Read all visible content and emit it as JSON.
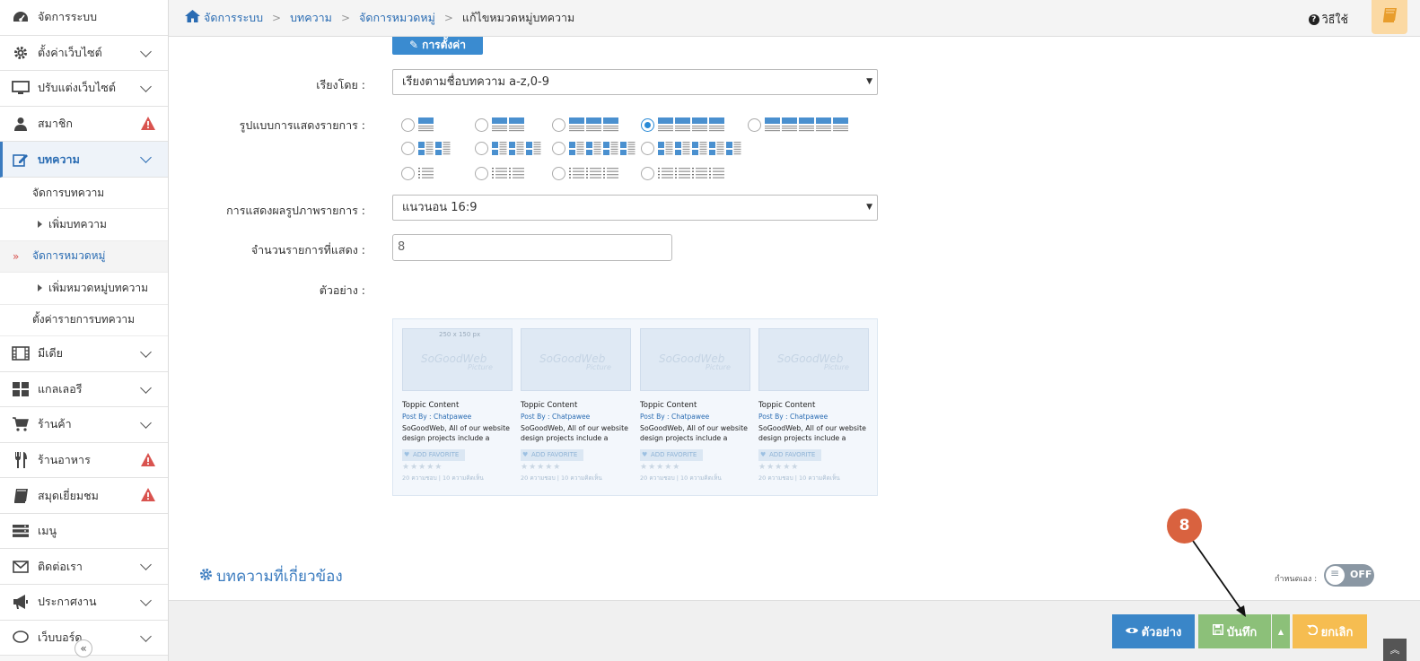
{
  "sidebar": {
    "items": [
      {
        "label": "จัดการระบบ",
        "icon": "dashboard-icon"
      },
      {
        "label": "ตั้งค่าเว็บไซต์",
        "icon": "gear-icon"
      },
      {
        "label": "ปรับแต่งเว็บไซต์",
        "icon": "monitor-icon"
      },
      {
        "label": "สมาชิก",
        "icon": "user-icon"
      },
      {
        "label": "บทความ",
        "icon": "edit-icon"
      },
      {
        "label": "มีเดีย",
        "icon": "film-icon"
      },
      {
        "label": "แกลเลอรี",
        "icon": "grid-icon"
      },
      {
        "label": "ร้านค้า",
        "icon": "cart-icon"
      },
      {
        "label": "ร้านอาหาร",
        "icon": "cutlery-icon"
      },
      {
        "label": "สมุดเยี่ยมชม",
        "icon": "book-icon"
      },
      {
        "label": "เมนู",
        "icon": "menu-icon"
      },
      {
        "label": "ติดต่อเรา",
        "icon": "envelope-icon"
      },
      {
        "label": "ประกาศงาน",
        "icon": "megaphone-icon"
      },
      {
        "label": "เว็บบอร์ด",
        "icon": "chat-icon"
      }
    ],
    "article_subitems": [
      "จัดการบทความ",
      "เพิ่มบทความ",
      "จัดการหมวดหมู่",
      "เพิ่มหมวดหมู่บทความ",
      "ตั้งค่ารายการบทความ"
    ],
    "collapse_label": "«"
  },
  "breadcrumb": [
    "จัดการระบบ",
    "บทความ",
    "จัดการหมวดหมู่",
    "แก้ไขหมวดหมู่บทความ"
  ],
  "header": {
    "help_label": "วิธีใช้"
  },
  "form": {
    "settings_button": "การตั้งค่า",
    "sort_label": "เรียงโดย :",
    "sort_value": "เรียงตามชื่อบทความ a-z,0-9",
    "layout_label": "รูปแบบการแสดงรายการ :",
    "image_label": "การแสดงผลรูปภาพรายการ :",
    "image_value": "แนวนอน 16:9",
    "count_label": "จำนวนรายการที่แสดง :",
    "count_value": "8",
    "preview_label": "ตัวอย่าง :"
  },
  "preview_cards": [
    {
      "title": "Toppic Content",
      "by": "Post By : Chatpawee",
      "desc": "SoGoodWeb, All of our website design projects include a content manag system to easily update your",
      "fav": "ADD FAVORITE",
      "stars": "★★★★★",
      "meta": "20 ความชอบ | 10 ความคิดเห็น",
      "size": "250 x 150 px",
      "wm": "SoGoodWeb",
      "wm2": "Picture"
    },
    {
      "title": "Toppic Content",
      "by": "Post By : Chatpawee",
      "desc": "SoGoodWeb, All of our website design projects include a content manag system to easily update your",
      "fav": "ADD FAVORITE",
      "stars": "★★★★★",
      "meta": "20 ความชอบ | 10 ความคิดเห็น",
      "size": "",
      "wm": "SoGoodWeb",
      "wm2": "Picture"
    },
    {
      "title": "Toppic Content",
      "by": "Post By : Chatpawee",
      "desc": "SoGoodWeb, All of our website design projects include a content manag system to easily update your",
      "fav": "ADD FAVORITE",
      "stars": "★★★★★",
      "meta": "20 ความชอบ | 10 ความคิดเห็น",
      "size": "",
      "wm": "SoGoodWeb",
      "wm2": "Picture"
    },
    {
      "title": "Toppic Content",
      "by": "Post By : Chatpawee",
      "desc": "SoGoodWeb, All of our website design projects include a content manag system to easily update your",
      "fav": "ADD FAVORITE",
      "stars": "★★★★★",
      "meta": "20 ความชอบ | 10 ความคิดเห็น",
      "size": "",
      "wm": "SoGoodWeb",
      "wm2": "Picture"
    }
  ],
  "related": {
    "title": "บทความที่เกี่ยวข้อง",
    "toggle_label": "กำหนดเอง :",
    "toggle_state": "OFF"
  },
  "footer": {
    "preview_button": "ตัวอย่าง",
    "save_button": "บันทึก",
    "cancel_button": "ยกเลิก"
  },
  "annotation": {
    "step": "8"
  },
  "colors": {
    "primary": "#3a86c8",
    "save": "#8cc079",
    "cancel": "#f6bd51",
    "warning": "#d9534f",
    "badge": "#d9623f"
  }
}
